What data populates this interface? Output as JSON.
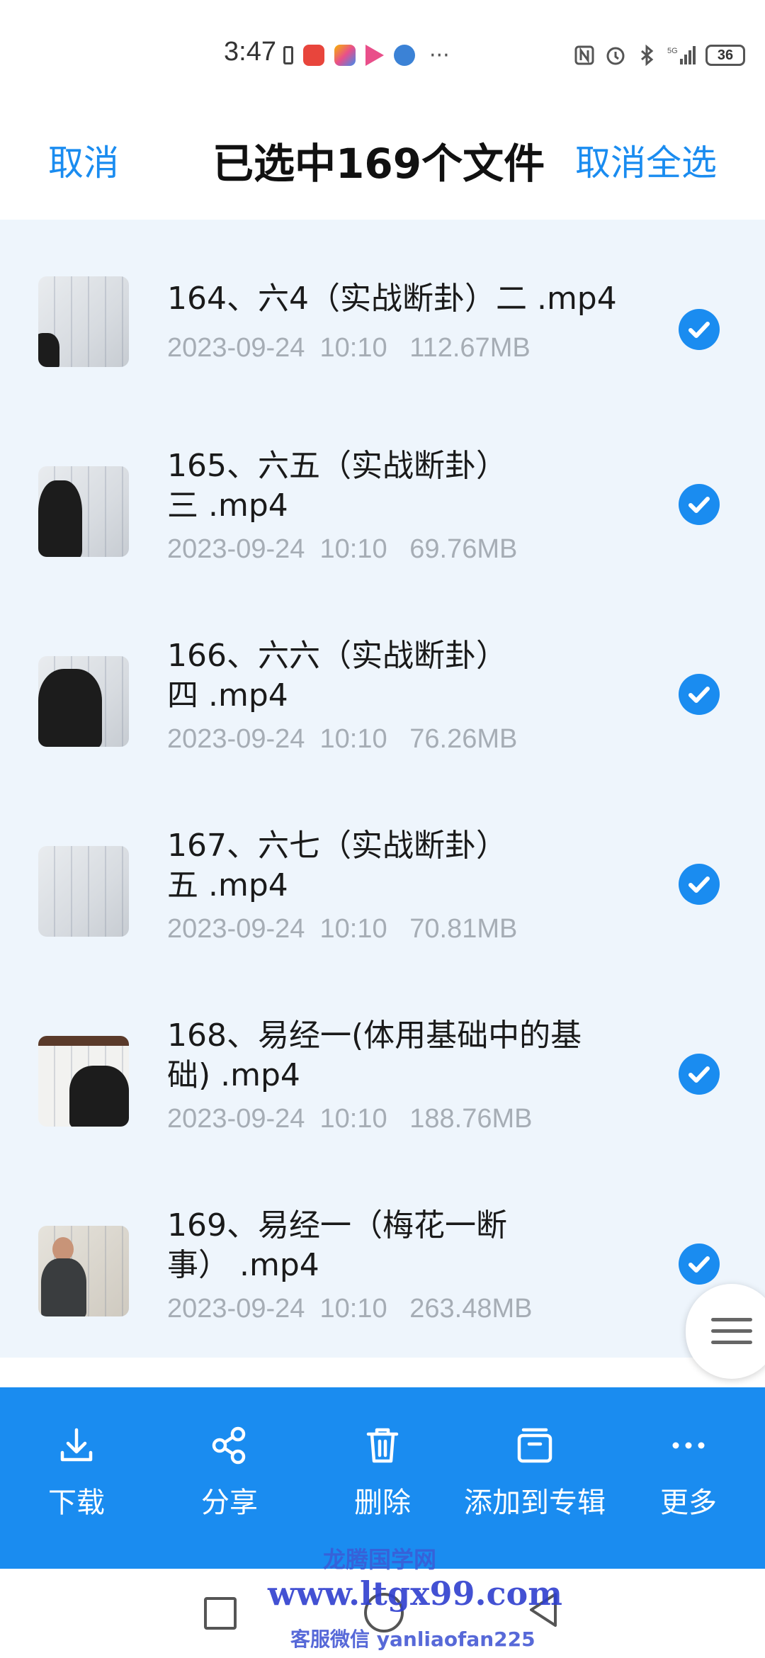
{
  "status_bar": {
    "time": "3:47",
    "battery": "36",
    "signal": "5G"
  },
  "header": {
    "cancel": "取消",
    "title": "已选中169个文件",
    "deselect_all": "取消全选"
  },
  "files": [
    {
      "name_line1": "164、六4（实战断卦）二 .mp4",
      "name_line2": "",
      "date": "2023-09-24  10:10",
      "size": "112.67MB",
      "selected": true
    },
    {
      "name_line1": "165、六五（实战断卦）",
      "name_line2": "三 .mp4",
      "date": "2023-09-24  10:10",
      "size": "69.76MB",
      "selected": true
    },
    {
      "name_line1": "166、六六（实战断卦）",
      "name_line2": "四 .mp4",
      "date": "2023-09-24  10:10",
      "size": "76.26MB",
      "selected": true
    },
    {
      "name_line1": "167、六七（实战断卦）",
      "name_line2": "五 .mp4",
      "date": "2023-09-24  10:10",
      "size": "70.81MB",
      "selected": true
    },
    {
      "name_line1": "168、易经一(体用基础中的基",
      "name_line2": "础) .mp4",
      "date": "2023-09-24  10:10",
      "size": "188.76MB",
      "selected": true
    },
    {
      "name_line1": "169、易经一（梅花一断",
      "name_line2": "事） .mp4",
      "date": "2023-09-24  10:10",
      "size": "263.48MB",
      "selected": true
    }
  ],
  "toolbar": {
    "download": "下载",
    "share": "分享",
    "delete": "删除",
    "add_to_album": "添加到专辑",
    "more": "更多"
  },
  "watermark": {
    "line1": "龙腾国学网",
    "line2": "www.ltgx99.com",
    "line3": "客服微信 yanliaofan225"
  },
  "colors": {
    "accent": "#1a8cf0",
    "list_bg": "#eef5fc",
    "meta_text": "#a6adb5"
  },
  "icons": [
    "download-icon",
    "share-icon",
    "trash-icon",
    "album-icon",
    "more-icon",
    "check-icon"
  ]
}
